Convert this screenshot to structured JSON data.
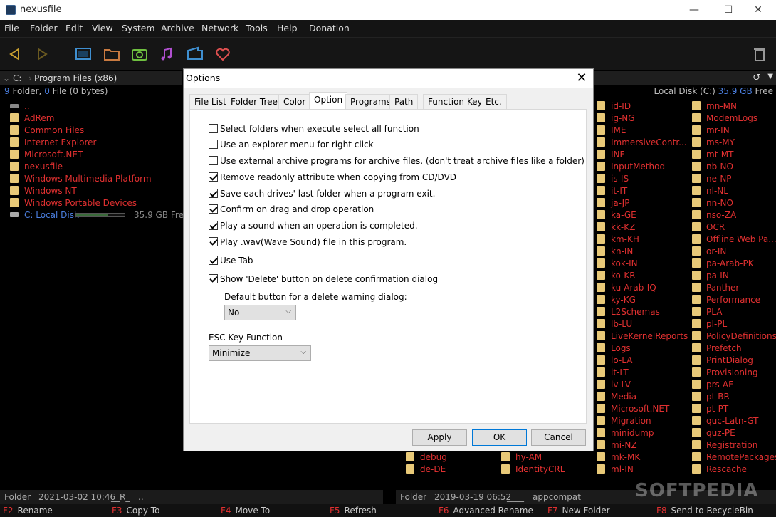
{
  "window": {
    "title": "nexusfile",
    "minimize": "—",
    "maximize": "☐",
    "close": "✕"
  },
  "menu": [
    "File",
    "Folder",
    "Edit",
    "View",
    "System",
    "Archive",
    "Network",
    "Tools",
    "Help",
    "Donation"
  ],
  "left_panel": {
    "drive": "C:",
    "path": "Program Files (x86)",
    "folder_count": "9",
    "folder_label": "Folder,",
    "file_count": "0",
    "file_label": "File",
    "bytes": "(0 bytes)",
    "items": [
      "..",
      "AdRem",
      "Common Files",
      "Internet Explorer",
      "Microsoft.NET",
      "nexusfile",
      "Windows Multimedia Platform",
      "Windows NT",
      "Windows Portable Devices"
    ],
    "drive_item": {
      "name": "C: Local Disk",
      "free": "35.9 GB Free",
      "usage_fraction": 0.66
    },
    "status": {
      "kind": "Folder",
      "date": "2021-03-02 10:46",
      "attr": "__R_",
      "name": ".."
    }
  },
  "right_panel": {
    "disk_label": "Local Disk (C:)",
    "disk_free": "35.9 GB",
    "free_label": "Free",
    "col1": [
      "id-ID",
      "ig-NG",
      "IME",
      "ImmersiveContr...",
      "INF",
      "InputMethod",
      "is-IS",
      "it-IT",
      "ja-JP",
      "ka-GE",
      "kk-KZ",
      "km-KH",
      "kn-IN",
      "kok-IN",
      "ko-KR",
      "ku-Arab-IQ",
      "ky-KG",
      "L2Schemas",
      "lb-LU",
      "LiveKernelReports",
      "Logs",
      "lo-LA",
      "lt-LT",
      "lv-LV",
      "Media",
      "Microsoft.NET",
      "Migration",
      "minidump",
      "mi-NZ",
      "mk-MK",
      "ml-IN"
    ],
    "col2": [
      "mn-MN",
      "ModemLogs",
      "mr-IN",
      "ms-MY",
      "mt-MT",
      "nb-NO",
      "ne-NP",
      "nl-NL",
      "nn-NO",
      "nso-ZA",
      "OCR",
      "Offline Web Pa...",
      "or-IN",
      "pa-Arab-PK",
      "pa-IN",
      "Panther",
      "Performance",
      "PLA",
      "pl-PL",
      "PolicyDefinitions",
      "Prefetch",
      "PrintDialog",
      "Provisioning",
      "prs-AF",
      "pt-BR",
      "pt-PT",
      "quc-Latn-GT",
      "quz-PE",
      "Registration",
      "RemotePackages",
      "Rescache"
    ],
    "bottom_left": [
      "debug",
      "de-DE"
    ],
    "bottom_mid": [
      "hy-AM",
      "IdentityCRL"
    ],
    "status": {
      "kind": "Folder",
      "date": "2019-03-19 06:52",
      "attr": "____",
      "name": "appcompat"
    }
  },
  "function_keys": [
    {
      "key": "F2",
      "label": "Rename"
    },
    {
      "key": "F3",
      "label": "Copy To"
    },
    {
      "key": "F4",
      "label": "Move To"
    },
    {
      "key": "F5",
      "label": "Refresh"
    },
    {
      "key": "F6",
      "label": "Advanced Rename"
    },
    {
      "key": "F7",
      "label": "New Folder"
    },
    {
      "key": "F8",
      "label": "Send to RecycleBin"
    }
  ],
  "watermark": "SOFTPEDIA",
  "dialog": {
    "title": "Options",
    "tabs": [
      "File List",
      "Folder Tree",
      "Color",
      "Option",
      "Programs",
      "Path",
      "Function Key",
      "Etc."
    ],
    "active_tab": "Option",
    "options": [
      {
        "label": "Select folders when execute select all function",
        "checked": false
      },
      {
        "label": "Use an explorer menu for right click",
        "checked": false
      },
      {
        "label": "Use external archive programs for archive files. (don't treat archive files like a folder)",
        "checked": false
      },
      {
        "label": "Remove readonly attribute when copying from CD/DVD",
        "checked": true
      },
      {
        "label": "Save each drives' last folder when a program exit.",
        "checked": true
      },
      {
        "label": "Confirm on drag and drop operation",
        "checked": true
      },
      {
        "label": "Play a sound when an operation is completed.",
        "checked": true
      },
      {
        "label": "Play .wav(Wave Sound) file in this program.",
        "checked": true
      },
      {
        "label": "Use Tab",
        "checked": true
      },
      {
        "label": "Show 'Delete' button on delete confirmation dialog",
        "checked": true
      }
    ],
    "default_button_label": "Default button for a delete warning dialog:",
    "default_button_value": "No",
    "esc_label": "ESC Key Function",
    "esc_value": "Minimize",
    "buttons": {
      "apply": "Apply",
      "ok": "OK",
      "cancel": "Cancel"
    }
  },
  "colors": {
    "accent_red": "#e03030",
    "accent_blue": "#4b7fe0",
    "folder": "#e8c978"
  }
}
